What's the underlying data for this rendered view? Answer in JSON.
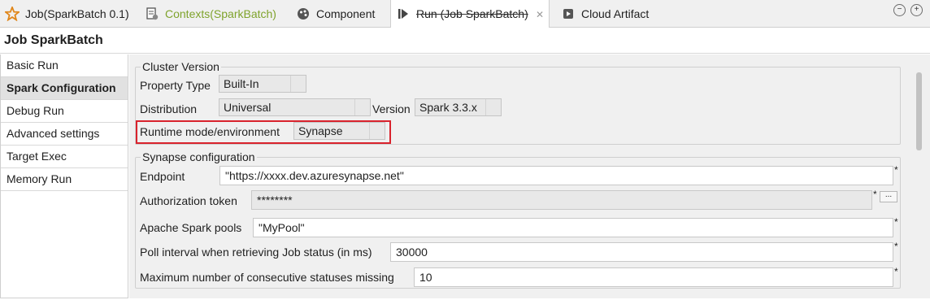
{
  "tabs": [
    {
      "label": "Job(SparkBatch 0.1)",
      "icon": "job-star-icon"
    },
    {
      "label": "Contexts(SparkBatch)",
      "icon": "contexts-icon"
    },
    {
      "label": "Component",
      "icon": "component-icon"
    },
    {
      "label": "Run (Job SparkBatch)",
      "icon": "run-icon",
      "active": true
    },
    {
      "label": "Cloud Artifact",
      "icon": "cloud-artifact-icon"
    }
  ],
  "window_controls": {
    "minimize": "−",
    "maximize": "+"
  },
  "page_title": "Job SparkBatch",
  "sidebar": {
    "items": [
      {
        "label": "Basic Run"
      },
      {
        "label": "Spark Configuration",
        "active": true
      },
      {
        "label": "Debug Run"
      },
      {
        "label": "Advanced settings"
      },
      {
        "label": "Target Exec"
      },
      {
        "label": "Memory Run"
      }
    ]
  },
  "cluster": {
    "legend": "Cluster Version",
    "property_type_label": "Property Type",
    "property_type_value": "Built-In",
    "distribution_label": "Distribution",
    "distribution_value": "Universal",
    "version_label": "Version",
    "version_value": "Spark 3.3.x",
    "runtime_label": "Runtime mode/environment",
    "runtime_value": "Synapse"
  },
  "synapse": {
    "legend": "Synapse configuration",
    "endpoint_label": "Endpoint",
    "endpoint_value": "\"https://xxxx.dev.azuresynapse.net\"",
    "auth_label": "Authorization token",
    "auth_value": "********",
    "pools_label": "Apache Spark pools",
    "pools_value": "\"MyPool\"",
    "poll_label": "Poll interval when retrieving Job status (in ms)",
    "poll_value": "30000",
    "max_missing_label": "Maximum number of consecutive statuses missing",
    "max_missing_value": "10",
    "required_mark": "*",
    "more_button": "..."
  },
  "colors": {
    "highlight": "#d9232d",
    "contexts_green": "#7fa32c"
  }
}
